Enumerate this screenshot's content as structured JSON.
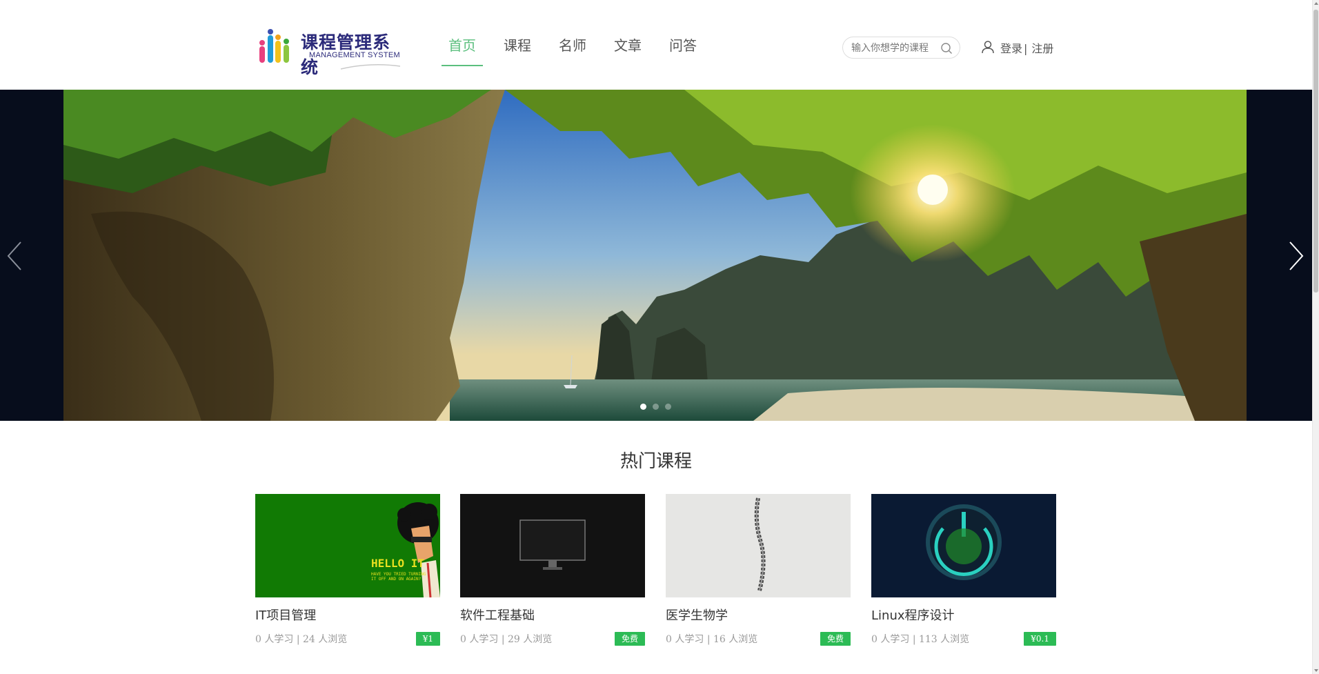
{
  "header": {
    "logo_title": "课程管理系统",
    "logo_subtitle": "MANAGEMENT SYSTEM",
    "nav": [
      {
        "label": "首页",
        "active": true
      },
      {
        "label": "课程",
        "active": false
      },
      {
        "label": "名师",
        "active": false
      },
      {
        "label": "文章",
        "active": false
      },
      {
        "label": "问答",
        "active": false
      }
    ],
    "search_placeholder": "输入你想学的课程",
    "login_label": "登录",
    "separator": "|",
    "register_label": "注册"
  },
  "banner": {
    "slide_count": 3,
    "active_slide": 1
  },
  "hot_courses": {
    "title": "热门课程",
    "items": [
      {
        "name": "IT项目管理",
        "learners": "0 人学习",
        "views": "24 人浏览",
        "price": "¥1"
      },
      {
        "name": "软件工程基础",
        "learners": "0 人学习",
        "views": "29 人浏览",
        "price": "免费"
      },
      {
        "name": "医学生物学",
        "learners": "0 人学习",
        "views": "16 人浏览",
        "price": "免费"
      },
      {
        "name": "Linux程序设计",
        "learners": "0 人学习",
        "views": "113 人浏览",
        "price": "¥0.1"
      }
    ],
    "meta_separator": "|"
  },
  "colors": {
    "accent": "#5bbf7e",
    "price_badge": "#2cbb55",
    "logo": "#2b2a7a"
  },
  "icons": {
    "search": "search-icon",
    "user": "user-icon",
    "prev": "chevron-left-icon",
    "next": "chevron-right-icon"
  }
}
